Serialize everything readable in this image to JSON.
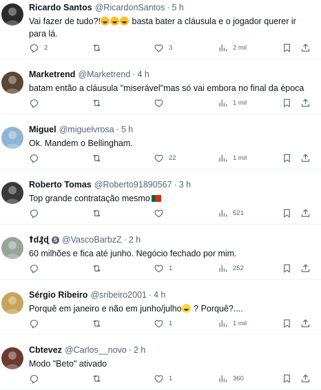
{
  "posts": [
    {
      "name": "Ricardo Santos",
      "handle": "@RicardonSantos",
      "time": "5 h",
      "text_before": "Vai fazer de tudo?!",
      "emojis": [
        "rofl",
        "rofl",
        "rofl"
      ],
      "text_after": " basta bater a cláusula e o jogador querer ir para lá.",
      "replies": "2",
      "reposts": "",
      "likes": "3",
      "views": "2 mil",
      "avatar_color": "#2b2b2b"
    },
    {
      "name": "Marketrend",
      "handle": "@Marketrend",
      "time": "4 h",
      "text": "batam então a cláusula \"miserável\"mas só vai embora no final da época",
      "replies": "",
      "reposts": "",
      "likes": "",
      "views": "1 mil",
      "avatar_color": "#5a4634"
    },
    {
      "name": "Miguel",
      "handle": "@miguelvrosa",
      "time": "5 h",
      "text": "Ok. Mandem o Bellingham.",
      "replies": "",
      "reposts": "",
      "likes": "22",
      "views": "1 mil",
      "avatar_color": "#8fb4d6"
    },
    {
      "name": "Roberto Tomas",
      "handle": "@Roberto91890567",
      "time": "3 h",
      "text": "Top grande contratação mesmo",
      "trailing_icon": "portugal-flag",
      "replies": "",
      "reposts": "",
      "likes": "",
      "views": "521",
      "avatar_color": "#3a3a3a"
    },
    {
      "name": "ꝉԁ₰ɖ",
      "handle": "@VascoBarbzZ",
      "time": "2 h",
      "badge": "S",
      "text": "60 milhões e fica até junho. Negócio fechado por mim.",
      "replies": "",
      "reposts": "",
      "likes": "1",
      "views": "252",
      "avatar_color": "#9aa39a"
    },
    {
      "name": "Sérgio Ribeiro",
      "handle": "@sribeiro2001",
      "time": "4 h",
      "text_before": "Porquê em janeiro e não em junho/julho",
      "emojis": [
        "sad"
      ],
      "text_after": " ? Porquê?....",
      "replies": "",
      "reposts": "",
      "likes": "1",
      "views": "1 mil",
      "avatar_color": "#c9a35a"
    },
    {
      "name": "Cbtevez",
      "handle": "@Carlos__novo",
      "time": "2 h",
      "text": "Modo \"Beto\" ativado",
      "replies": "",
      "reposts": "",
      "likes": "1",
      "views": "360",
      "avatar_color": "#6b3a2e"
    }
  ],
  "icons": {
    "reply": "reply-icon",
    "repost": "repost-icon",
    "like": "like-icon",
    "views": "views-icon",
    "bookmark": "bookmark-icon",
    "share": "share-icon"
  },
  "colors": {
    "text": "#0f1419",
    "secondary": "#536471",
    "divider": "#eff3f4"
  }
}
